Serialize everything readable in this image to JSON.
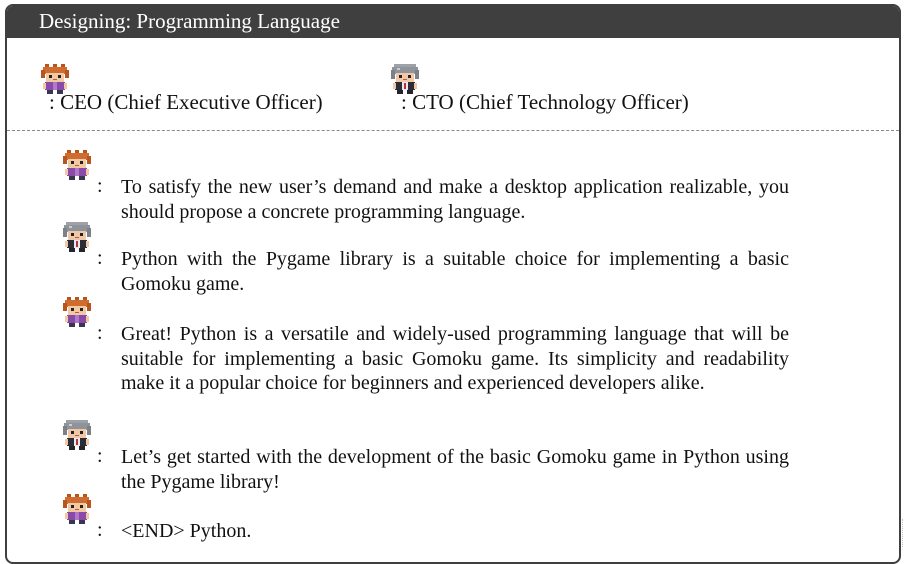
{
  "title": "Designing: Programming Language",
  "roles": [
    {
      "avatar": "ceo-avatar-icon",
      "label": ": CEO (Chief Executive Officer)"
    },
    {
      "avatar": "cto-avatar-icon",
      "label": ": CTO (Chief Technology Officer)"
    }
  ],
  "colon": ":",
  "messages": [
    {
      "speaker": "CEO",
      "text": "To satisfy the new user’s demand and make a desktop application realizable, you should propose a concrete programming language."
    },
    {
      "speaker": "CTO",
      "text": "Python with the Pygame library is a suitable choice for implementing a basic Gomoku game."
    },
    {
      "speaker": "CEO",
      "text": "Great! Python is a versatile and widely-used programming language that will be suitable for implementing a basic Gomoku game.  Its simplicity and readability make it a popular choice for beginners and experienced developers alike."
    },
    {
      "speaker": "CTO",
      "text": "Let’s get started with the development of the basic Gomoku game in Python using the Pygame library!"
    },
    {
      "speaker": "CEO",
      "text": "<END> Python."
    }
  ],
  "colors": {
    "title_bar": "#3f3f3f",
    "ceo_hair": "#c8642d",
    "cto_hair": "#8f939a"
  }
}
